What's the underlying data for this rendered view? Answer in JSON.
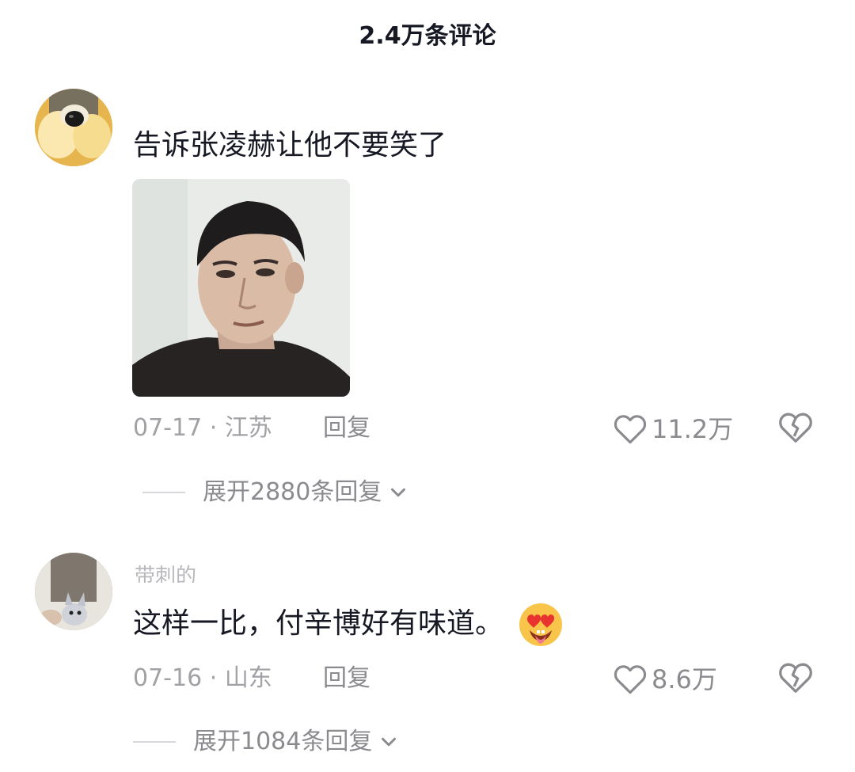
{
  "header": {
    "title": "2.4万条评论"
  },
  "comments": [
    {
      "username": "",
      "text": "告诉张凌赫让他不要笑了",
      "has_image": true,
      "date": "07-17",
      "location": "江苏",
      "reply_label": "回复",
      "like_count": "11.2万",
      "expand_label": "展开2880条回复"
    },
    {
      "username": "带刺的",
      "text": "这样一比，付辛博好有味道。",
      "emoji": "heart-eyes-tongue-emoji",
      "date": "07-16",
      "location": "山东",
      "reply_label": "回复",
      "like_count": "8.6万",
      "expand_label": "展开1084条回复"
    }
  ],
  "icons": {
    "like": "heart-outline-icon",
    "dislike": "broken-heart-icon",
    "expand": "chevron-down-icon"
  },
  "colors": {
    "text_primary": "#161823",
    "text_secondary": "#8a8a8f",
    "text_muted": "#a1a1a6",
    "background": "#ffffff"
  }
}
